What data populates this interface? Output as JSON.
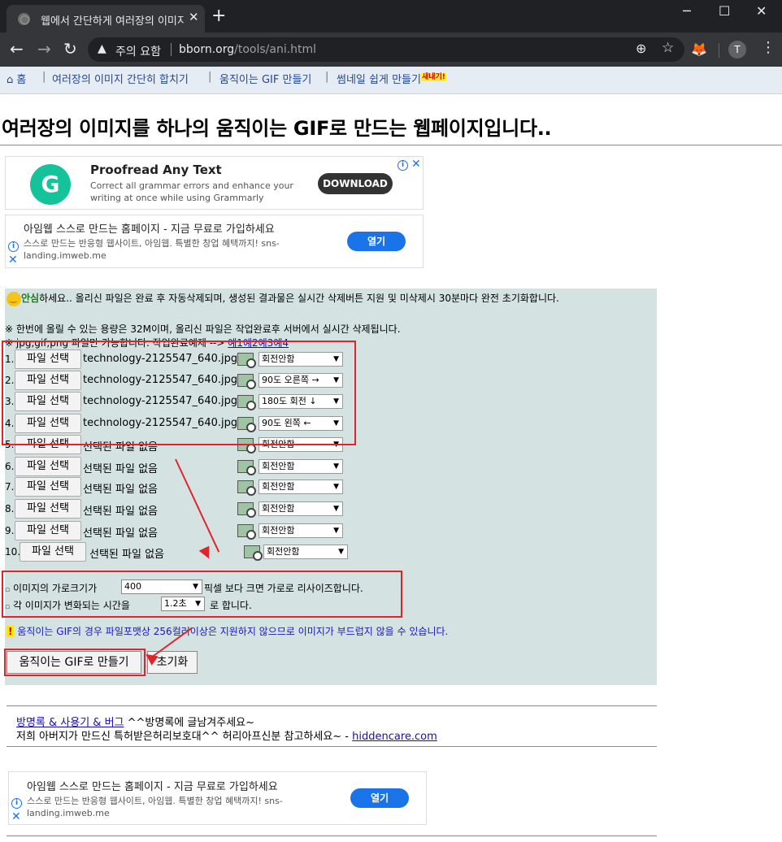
{
  "browser": {
    "tab_title": "웹에서 간단하게 여러장의 이미지",
    "tab_close": "✕",
    "new_tab": "+",
    "window": {
      "minimize": "─",
      "maximize": "☐",
      "close": "✕"
    },
    "security_label": "주의 요함",
    "url_host": "bborn.org",
    "url_path": "/tools/ani.html",
    "avatar_letter": "T"
  },
  "nav": {
    "home": "홈",
    "items": [
      "여러장의 이미지 간단히 합치기",
      "움직이는 GIF 만들기",
      "썸네일 쉽게 만들기"
    ],
    "new_badge": "새내기!"
  },
  "heading": "여러장의 이미지를 하나의 움직이는 GIF로 만드는 웹페이지입니다..",
  "ad_grammarly": {
    "logo": "G",
    "title": "Proofread Any Text",
    "desc_line1": "Correct all grammar errors and enhance your",
    "desc_line2": "writing at once while using Grammarly",
    "cta": "DOWNLOAD",
    "info": "i",
    "close": "✕",
    "accent": "#15c39a"
  },
  "ad_imweb": {
    "title": "아임웹 스스로 만드는 홈페이지 - 지금 무료로 가입하세요",
    "desc_line1": "스스로 만드는 반응형 웹사이트, 아임웹. 특별한 창업 혜택까지! sns-",
    "desc_line2": "landing.imweb.me",
    "cta": "열기",
    "info": "i",
    "close": "✕",
    "cta_color": "#1a73e8"
  },
  "panel": {
    "notice_strong": "안심",
    "notice_rest": "하세요.. 올리신 파일은 완료 후 자동삭제되며, 생성된 결과물은 실시간 삭제버튼 지원 및 미삭제시 30분마다 완전 초기화합니다.",
    "size_note": "※ 한번에 올릴 수 있는 용량은 32M이며, 올리신 파일은 작업완료후 서버에서 실시간 삭제됩니다.",
    "format_note": "※ jpg,gif,png 파일만 가능합니다. 작업완료예제 -->",
    "examples": [
      "예1",
      "예2",
      "예3",
      "예4"
    ],
    "file_button": "파일 선택",
    "files": [
      {
        "num": "1.",
        "name": "technology-2125547_640.jpg",
        "rotation": "회전안함"
      },
      {
        "num": "2.",
        "name": "technology-2125547_640.jpg",
        "rotation": "90도 오른쪽 →"
      },
      {
        "num": "3.",
        "name": "technology-2125547_640.jpg",
        "rotation": "180도 회전 ↓"
      },
      {
        "num": "4.",
        "name": "technology-2125547_640.jpg",
        "rotation": "90도 왼쪽 ←"
      },
      {
        "num": "5.",
        "name": "선택된 파일 없음",
        "rotation": "회전안함"
      },
      {
        "num": "6.",
        "name": "선택된 파일 없음",
        "rotation": "회전안함"
      },
      {
        "num": "7.",
        "name": "선택된 파일 없음",
        "rotation": "회전안함"
      },
      {
        "num": "8.",
        "name": "선택된 파일 없음",
        "rotation": "회전안함"
      },
      {
        "num": "9.",
        "name": "선택된 파일 없음",
        "rotation": "회전안함"
      },
      {
        "num": "10.",
        "name": "선택된 파일 없음",
        "rotation": "회전안함"
      }
    ],
    "option_width_prefix": "이미지의 가로크기가",
    "option_width_value": "400",
    "option_width_suffix": "픽셀 보다 크면 가로로 리사이즈합니다.",
    "option_time_prefix": "각 이미지가 변화되는 시간을",
    "option_time_value": "1.2초",
    "option_time_suffix": "로 합니다.",
    "warning_mark": "!",
    "warning": "움직이는 GIF의 경우 파일포맷상 256컬러이상은 지원하지 않으므로 이미지가 부드럽지 않을 수 있습니다.",
    "make_button": "움직이는 GIF로 만들기",
    "reset_button": "초기화",
    "dropdown_arrow": "▼",
    "annotation_color": "#e0242c"
  },
  "footer": {
    "guestbook_link": "방명록 & 사용기 & 버그",
    "guestbook_text": " ^^방명록에 글남겨주세요~",
    "line2_text": "저희 아버지가 만드신 특허받은허리보호대^^ 허리아프신분 참고하세요~ - ",
    "line2_link": "hiddencare.com"
  }
}
